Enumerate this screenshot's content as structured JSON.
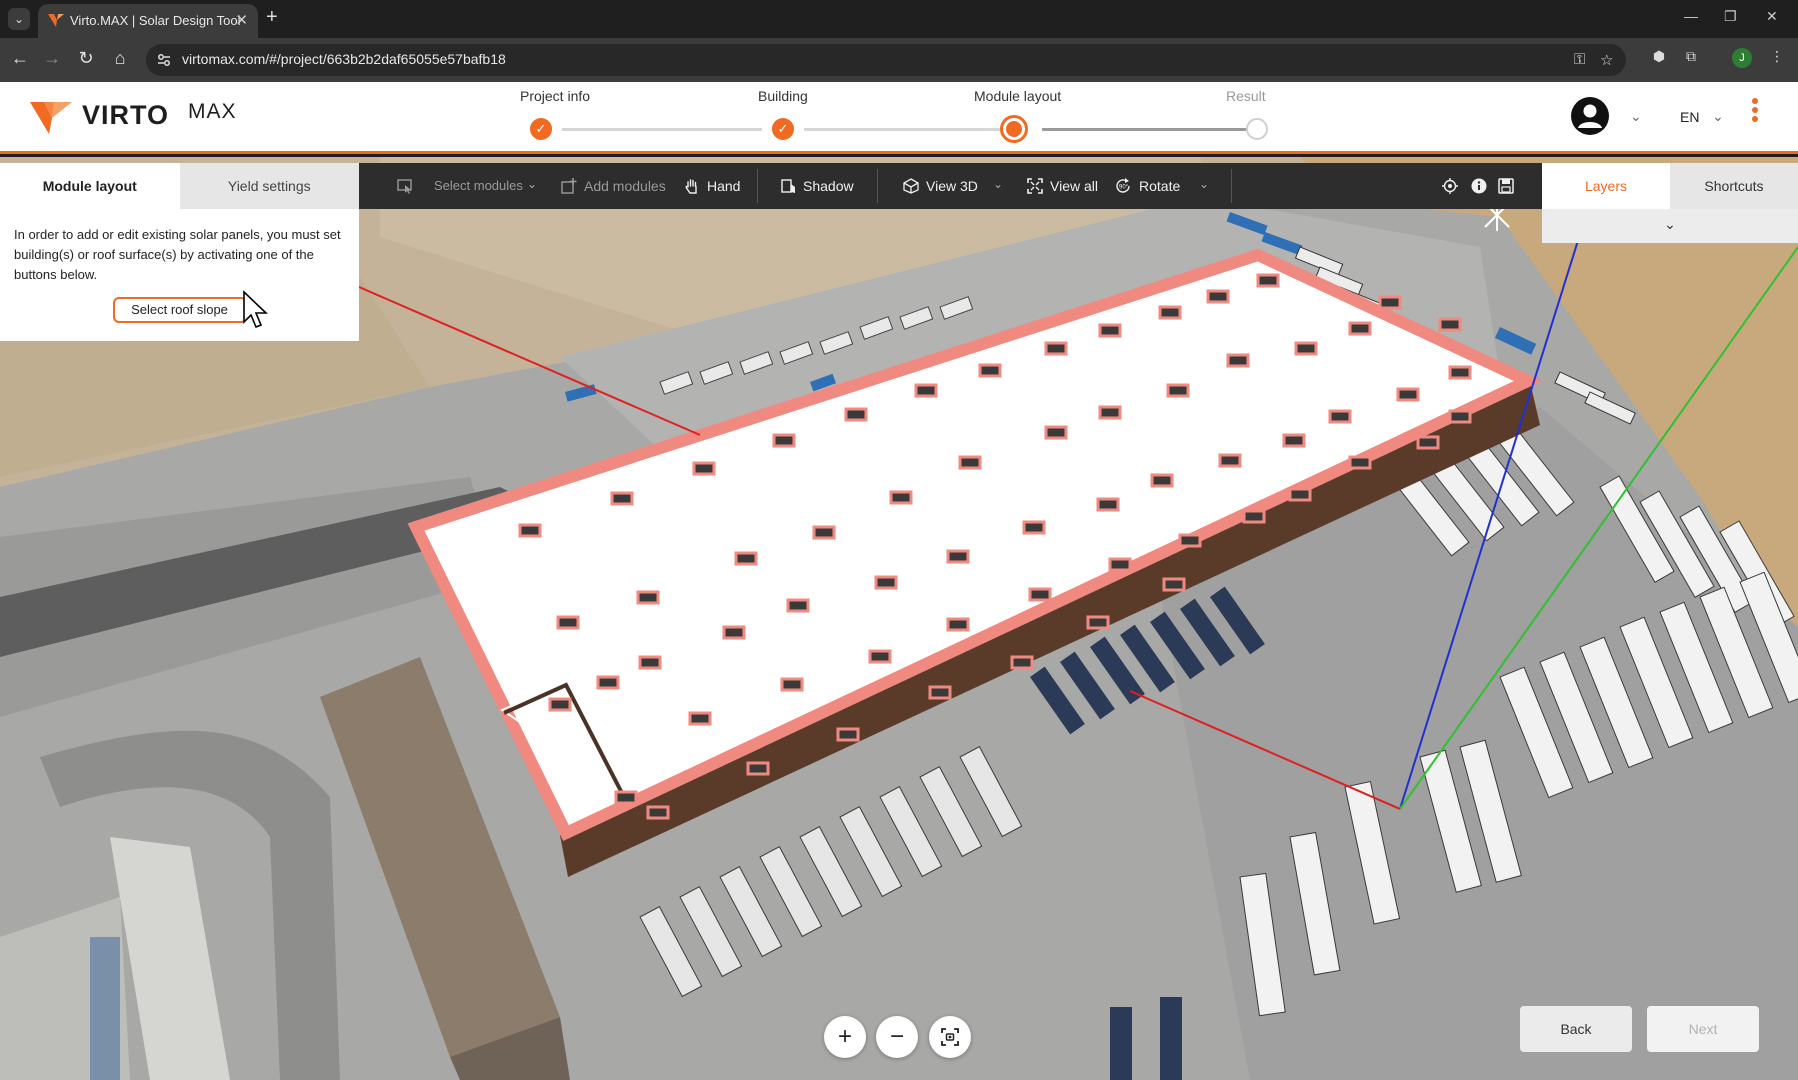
{
  "browser": {
    "tab_title": "Virto.MAX | Solar Design Tool",
    "url": "virtomax.com/#/project/663b2b2daf65055e57bafb18",
    "profile_initial": "J"
  },
  "brand": {
    "name": "VIRTO",
    "suffix": "MAX",
    "accent": "#f06a22"
  },
  "steps": [
    {
      "label": "Project info",
      "state": "done"
    },
    {
      "label": "Building",
      "state": "done"
    },
    {
      "label": "Module layout",
      "state": "active"
    },
    {
      "label": "Result",
      "state": "pending"
    }
  ],
  "header": {
    "language": "EN"
  },
  "left_panel": {
    "tabs": [
      {
        "label": "Module layout",
        "active": true
      },
      {
        "label": "Yield settings",
        "active": false
      }
    ],
    "instruction": "In order to add or edit existing solar panels, you must set building(s) or roof surface(s) by activating one of the buttons below.",
    "button_label": "Select roof slope"
  },
  "toolbar": {
    "select_modules": "Select modules",
    "add_modules": "Add modules",
    "hand": "Hand",
    "shadow": "Shadow",
    "view3d": "View 3D",
    "view_all": "View all",
    "rotate": "Rotate"
  },
  "right_panel": {
    "tabs": [
      {
        "label": "Layers",
        "active": true
      },
      {
        "label": "Shortcuts",
        "active": false
      }
    ]
  },
  "zoom": {
    "in": "+",
    "out": "−"
  },
  "footer": {
    "back": "Back",
    "next": "Next"
  }
}
